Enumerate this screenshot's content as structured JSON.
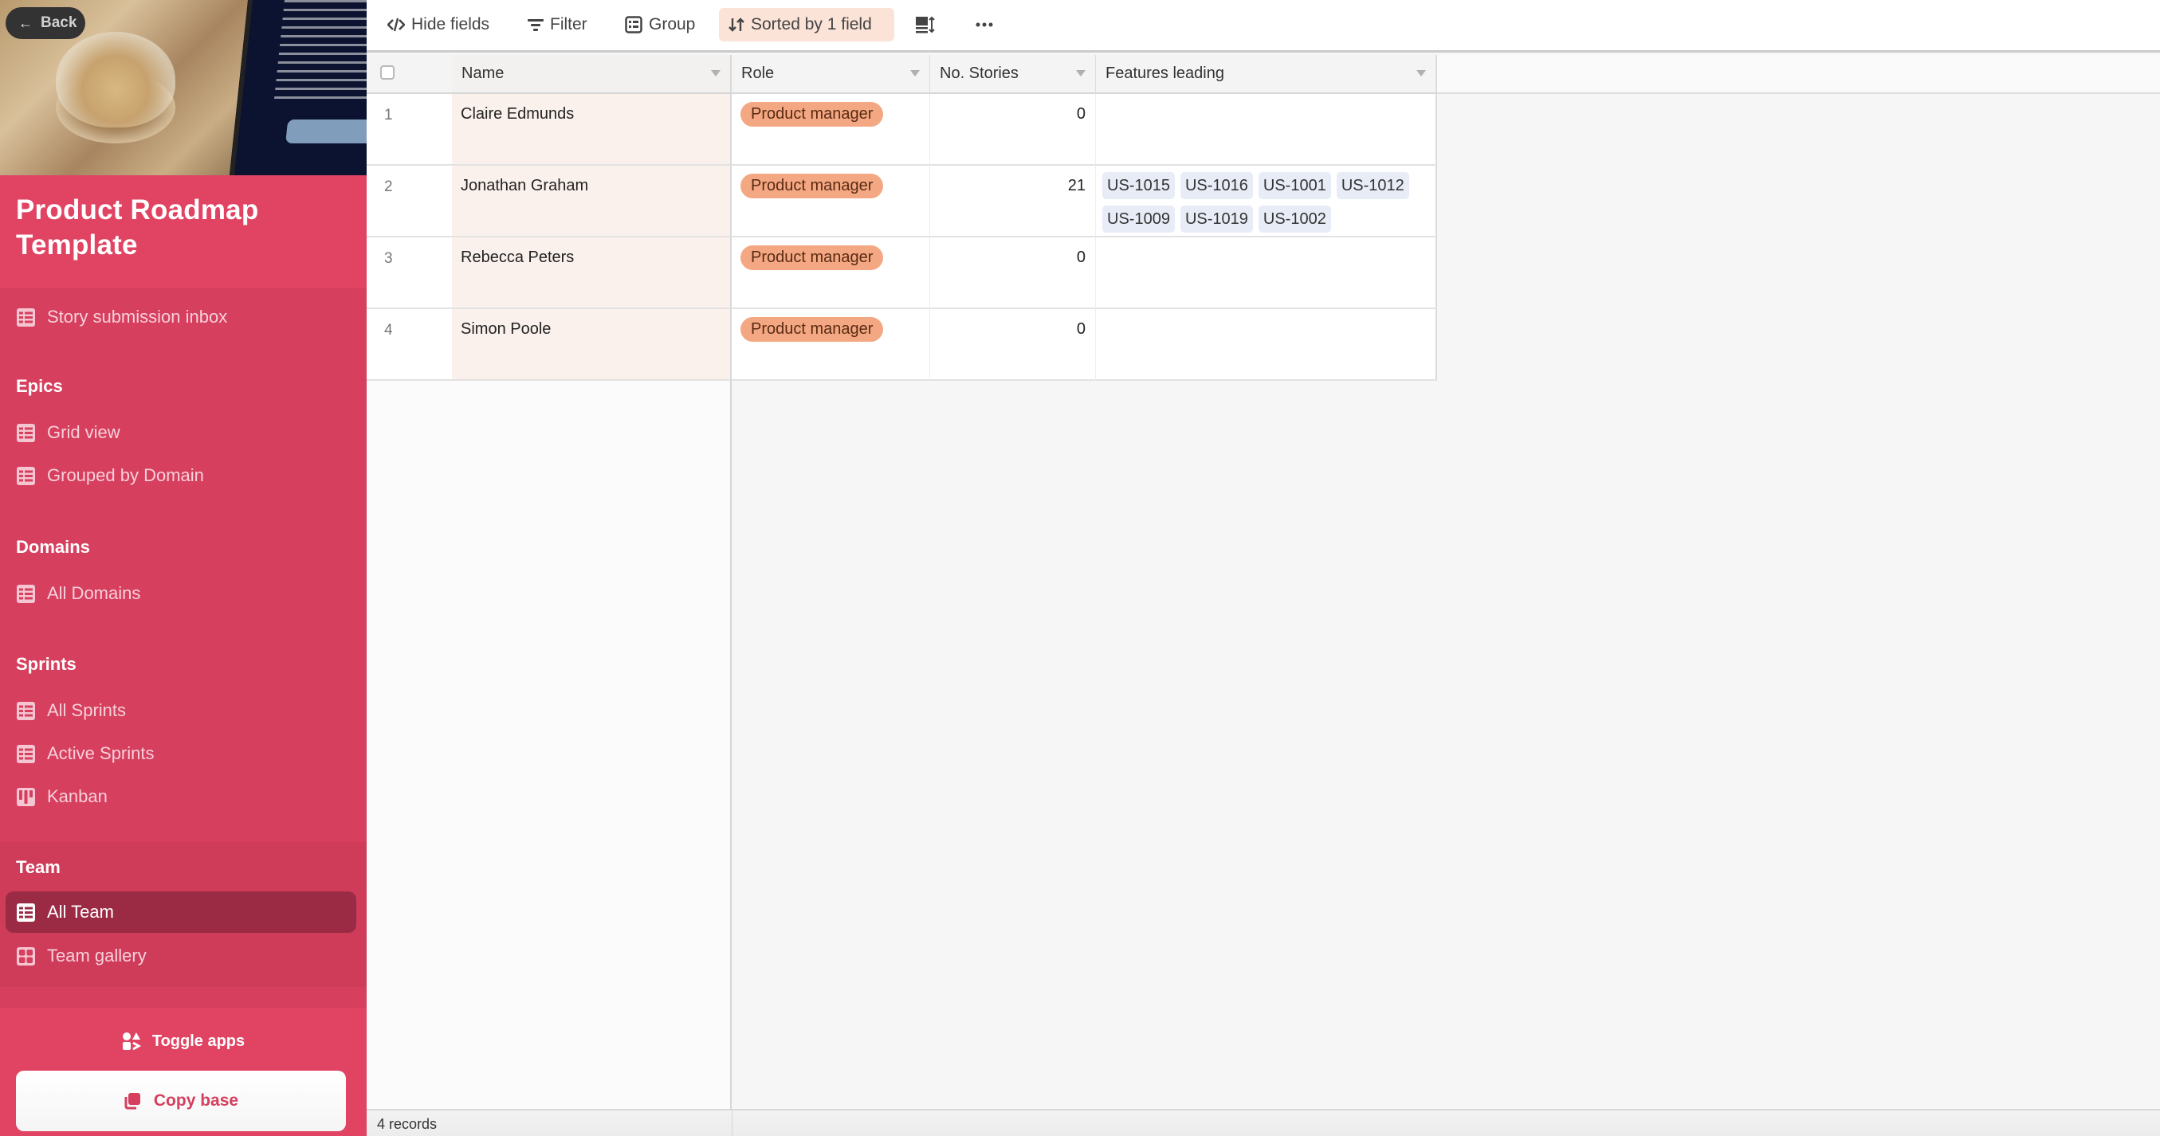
{
  "sidebar": {
    "back_label": "Back",
    "base_title": "Product Roadmap Template",
    "standalone_items": [
      {
        "label": "Story submission inbox",
        "icon": "grid-icon"
      }
    ],
    "sections": [
      {
        "heading": "Epics",
        "items": [
          {
            "label": "Grid view",
            "icon": "grid-icon"
          },
          {
            "label": "Grouped by Domain",
            "icon": "grid-icon"
          }
        ]
      },
      {
        "heading": "Domains",
        "items": [
          {
            "label": "All Domains",
            "icon": "grid-icon"
          }
        ]
      },
      {
        "heading": "Sprints",
        "items": [
          {
            "label": "All Sprints",
            "icon": "grid-icon"
          },
          {
            "label": "Active Sprints",
            "icon": "grid-icon"
          },
          {
            "label": "Kanban",
            "icon": "kanban-icon"
          }
        ]
      },
      {
        "heading": "Team",
        "items": [
          {
            "label": "All Team",
            "icon": "grid-icon",
            "active": true
          },
          {
            "label": "Team gallery",
            "icon": "gallery-icon"
          }
        ]
      }
    ],
    "toggle_apps_label": "Toggle apps",
    "copy_base_label": "Copy base",
    "accent_color": "#e14363",
    "active_color": "#9b2b45"
  },
  "toolbar": {
    "hide_fields_label": "Hide fields",
    "filter_label": "Filter",
    "group_label": "Group",
    "sort_label": "Sorted by 1 field",
    "row_height_icon": "row-height-icon",
    "more_icon": "more-icon"
  },
  "table": {
    "columns": [
      "Name",
      "Role",
      "No. Stories",
      "Features leading"
    ],
    "rows": [
      {
        "num": "1",
        "name": "Claire Edmunds",
        "role": "Product manager",
        "stories": "0",
        "features": []
      },
      {
        "num": "2",
        "name": "Jonathan Graham",
        "role": "Product manager",
        "stories": "21",
        "features": [
          "US-1015",
          "US-1016",
          "US-1001",
          "US-1012",
          "US-1009",
          "US-1019",
          "US-1002"
        ]
      },
      {
        "num": "3",
        "name": "Rebecca Peters",
        "role": "Product manager",
        "stories": "0",
        "features": []
      },
      {
        "num": "4",
        "name": "Simon Poole",
        "role": "Product manager",
        "stories": "0",
        "features": []
      }
    ],
    "role_pill_color": "#f3a883",
    "feature_chip_color": "#e8ecf7"
  },
  "status": {
    "record_count": "4 records"
  }
}
